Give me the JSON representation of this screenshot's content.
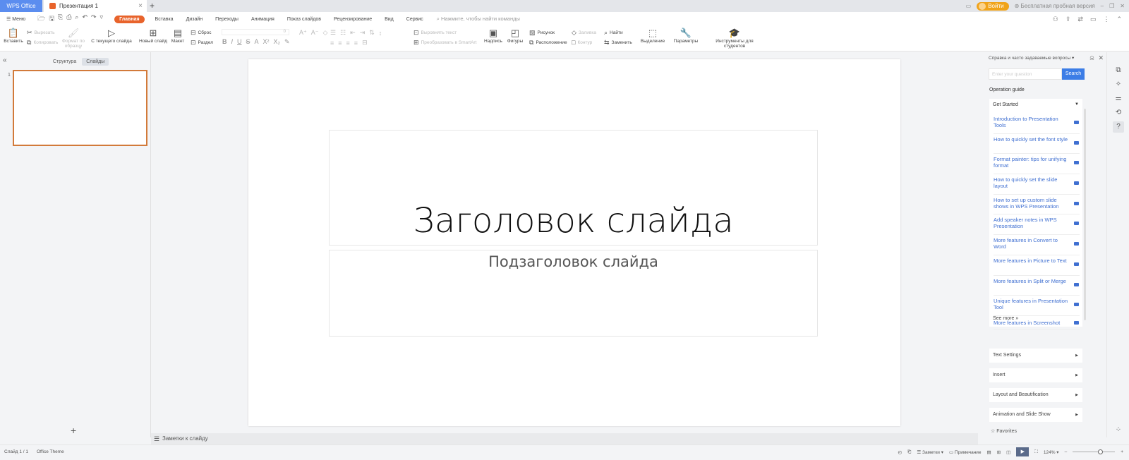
{
  "tabs": {
    "app": "WPS Office",
    "document": "Презентация 1",
    "close_icon": "×",
    "add_icon": "+"
  },
  "window": {
    "login_label": "Войти",
    "trial_label": "Бесплатная пробная версия",
    "minimize": "–",
    "restore": "❐",
    "close": "✕"
  },
  "menu": {
    "menu_label": "Меню",
    "items": [
      "Главная",
      "Вставка",
      "Дизайн",
      "Переходы",
      "Анимация",
      "Показ слайдов",
      "Рецензирование",
      "Вид",
      "Сервис"
    ],
    "active_index": 0,
    "search_placeholder": "Нажмите, чтобы найти команды"
  },
  "ribbon": {
    "paste": "Вставить",
    "cut": "Вырезать",
    "copy": "Копировать",
    "format_painter": "Формат по образцу",
    "from_current": "С текущего слайда",
    "new_slide": "Новый слайд",
    "layout": "Макет",
    "reset": "Сброс",
    "section": "Раздел",
    "font_size": "0",
    "align_text": "Выровнять текст",
    "smartart": "Преобразовать в SmartArt",
    "textbox": "Надпись",
    "shapes": "Фигуры",
    "picture": "Рисунок",
    "arrange": "Расположение",
    "fill": "Заливка",
    "outline": "Контур",
    "find": "Найти",
    "replace": "Заменить",
    "select": "Выделение",
    "params": "Параметры",
    "student_tools": "Инструменты для студентов"
  },
  "left_panel": {
    "tab_outline": "Структура",
    "tab_slides": "Слайды",
    "slide_number": "1",
    "add_icon": "+"
  },
  "slide": {
    "title": "Заголовок слайда",
    "subtitle": "Подзаголовок слайда"
  },
  "notes": {
    "placeholder": "Заметки к слайду"
  },
  "help": {
    "header": "Справка и часто задаваемые вопросы",
    "search_placeholder": "Enter your question",
    "search_button": "Search",
    "operation_guide": "Operation guide",
    "get_started": "Get Started",
    "items": [
      "Introduction to Presentation Tools",
      "How to quickly set the font style",
      "Format painter: tips for unifying format",
      "How to quickly set the slide layout",
      "How to set up custom slide shows in WPS Presentation",
      "Add speaker notes in WPS Presentation",
      "More features in Convert to Word",
      "More features in Picture to Text",
      "More features in Split or Merge",
      "Unique features in Presentation Tool",
      "More features in Screenshot"
    ],
    "see_more": "See more",
    "sections": [
      "Text Settings",
      "Insert",
      "Layout and Beautification",
      "Animation and Slide Show"
    ],
    "favorites": "Favorites"
  },
  "status": {
    "slide_info": "Слайд 1 / 1",
    "theme": "Office Theme",
    "notes_label": "Заметки",
    "comment_label": "Примечание",
    "zoom_level": "124%",
    "zoom_minus": "–",
    "zoom_plus": "+"
  },
  "colors": {
    "accent": "#e8632b",
    "link": "#3f6fd1",
    "search_button": "#3c7de6",
    "login": "#f0a31a"
  }
}
